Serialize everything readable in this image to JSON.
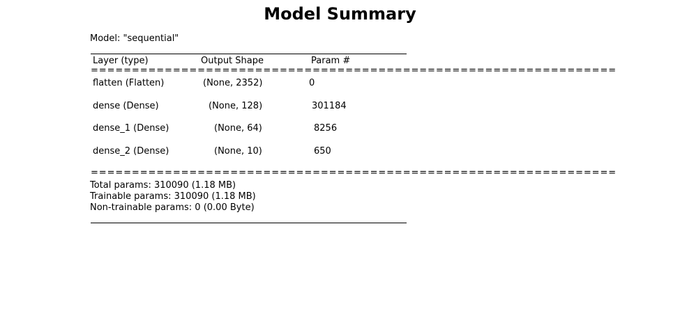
{
  "title": "Model Summary",
  "model_line": "Model: \"sequential\"",
  "headers": {
    "layer": "Layer (type)",
    "shape": "Output Shape",
    "params": "Param #"
  },
  "separator": "================================================================",
  "rows": [
    {
      "layer": "flatten (Flatten)",
      "shape": "(None, 2352)",
      "params": "0"
    },
    {
      "layer": "dense (Dense)",
      "shape": "(None, 128)",
      "params": "301184"
    },
    {
      "layer": "dense_1 (Dense)",
      "shape": "(None, 64)",
      "params": "8256"
    },
    {
      "layer": "dense_2 (Dense)",
      "shape": "(None, 10)",
      "params": "650"
    }
  ],
  "totals": {
    "total": "Total params: 310090 (1.18 MB)",
    "trainable": "Trainable params: 310090 (1.18 MB)",
    "non_trainable": "Non-trainable params: 0 (0.00 Byte)"
  }
}
